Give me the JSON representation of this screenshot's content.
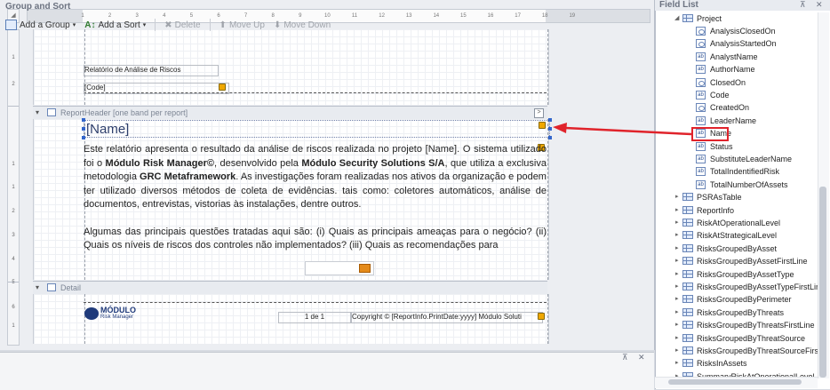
{
  "ruler": {
    "corner": "◢",
    "ticks": [
      "1",
      "2",
      "3",
      "4",
      "5",
      "6",
      "7",
      "8",
      "9",
      "10",
      "11",
      "12",
      "13",
      "14",
      "15",
      "16",
      "17",
      "18",
      "19"
    ],
    "vertical_marks": [
      "1",
      "2",
      "1",
      "1",
      "2",
      "3",
      "4",
      "5",
      "6",
      "1",
      "1",
      "2"
    ]
  },
  "report": {
    "page_header": {
      "title_field": "Relatório de Análise de Riscos",
      "code_field": "[Code]"
    },
    "report_header_band": {
      "label": "ReportHeader [one band per report]",
      "expand": "▾",
      "button": ">"
    },
    "name_field": "[Name]",
    "body": {
      "p1_a": "Este relatório apresenta o resultado da análise de riscos realizada no projeto [Name]. O sistema utilizado foi o ",
      "p1_b": "Módulo Risk Manager©",
      "p1_c": ", desenvolvido pela ",
      "p1_d": "Módulo Security Solutions S/A",
      "p1_e": ", que utiliza a exclusiva metodologia ",
      "p1_f": "GRC Metaframework",
      "p1_g": ". As investigações foram realizadas nos ativos da organização e podem ter utilizado diversos métodos de coleta de evidências. tais como: coletores automáticos, análise de documentos, entrevistas, vistorias às instalações, dentre outros.",
      "p2": "Algumas das principais questões tratadas aqui são: (i) Quais as principais ameaças para o negócio? (ii) Quais os níveis de riscos dos controles não implementados? (iii) Quais as recomendações para"
    },
    "detail_band": {
      "label": "Detail",
      "expand": "▾"
    },
    "footer": {
      "logo_top": "MÓDULO",
      "logo_bottom": "Risk Manager",
      "page_number": "1 de 1",
      "copyright": "Copyright © [ReportInfo.PrintDate:yyyy] Módulo Soluti"
    }
  },
  "group_sort": {
    "title": "Group and Sort",
    "pin": "⊼",
    "close": "✕",
    "add_group": "Add a Group",
    "add_sort": "Add a Sort",
    "delete": "Delete",
    "move_up": "Move Up",
    "move_down": "Move Down"
  },
  "field_list": {
    "title": "Field List",
    "pin": "⊼",
    "close": "✕",
    "project": "Project",
    "project_fields": [
      {
        "name": "AnalysisClosedOn",
        "type": "date"
      },
      {
        "name": "AnalysisStartedOn",
        "type": "date"
      },
      {
        "name": "AnalystName",
        "type": "text"
      },
      {
        "name": "AuthorName",
        "type": "text"
      },
      {
        "name": "ClosedOn",
        "type": "date"
      },
      {
        "name": "Code",
        "type": "text"
      },
      {
        "name": "CreatedOn",
        "type": "date"
      },
      {
        "name": "LeaderName",
        "type": "text"
      },
      {
        "name": "Name",
        "type": "text"
      },
      {
        "name": "Status",
        "type": "text"
      },
      {
        "name": "SubstituteLeaderName",
        "type": "text"
      },
      {
        "name": "TotalIndentifiedRisk",
        "type": "text"
      },
      {
        "name": "TotalNumberOfAssets",
        "type": "text"
      }
    ],
    "tables": [
      "PSRAsTable",
      "ReportInfo",
      "RiskAtOperationalLevel",
      "RiskAtStrategicalLevel",
      "RisksGroupedByAsset",
      "RisksGroupedByAssetFirstLine",
      "RisksGroupedByAssetType",
      "RisksGroupedByAssetTypeFirstLine",
      "RisksGroupedByPerimeter",
      "RisksGroupedByThreats",
      "RisksGroupedByThreatsFirstLine",
      "RisksGroupedByThreatSource",
      "RisksGroupedByThreatSourceFirstL",
      "RisksInAssets",
      "SummaryRiskAtOperationalLevel"
    ]
  },
  "colors": {
    "highlight": "#e0232b",
    "arrow": "#e0232b",
    "accent": "#2d3e6b"
  }
}
